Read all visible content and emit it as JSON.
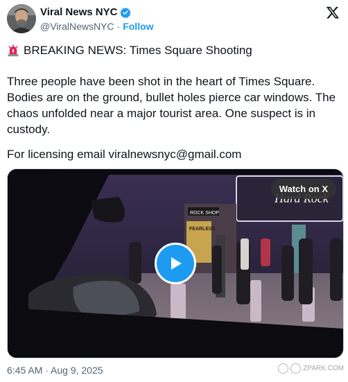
{
  "author": {
    "name": "Viral News NYC",
    "handle": "@ViralNewsNYC",
    "separator": "·",
    "follow": "Follow"
  },
  "post": {
    "headline_emoji": "🚨",
    "headline": "BREAKING NEWS: Times Square Shooting",
    "body": "Three people have been shot in the heart of Times Square. Bodies are on the ground, bullet holes pierce car windows. The chaos unfolded near a major tourist area. One suspect is in custody.",
    "licensing": "For licensing email viralnewsnyc@gmail.com",
    "timestamp": "6:45 AM · Aug 9, 2025"
  },
  "media": {
    "watch_label": "Watch on X",
    "signs": {
      "rock_shop": "ROCK SHOP",
      "hard_rock": "Hard Rock",
      "fearless": "FEARLESS"
    }
  },
  "watermark": {
    "text": "ZPARK.COM"
  },
  "colors": {
    "accent": "#1d9bf0",
    "text_primary": "#0f1419",
    "text_secondary": "#536471"
  },
  "icons": {
    "verified": "verified-badge-icon",
    "x_logo": "x-logo-icon",
    "siren": "siren-icon",
    "play": "play-icon"
  }
}
